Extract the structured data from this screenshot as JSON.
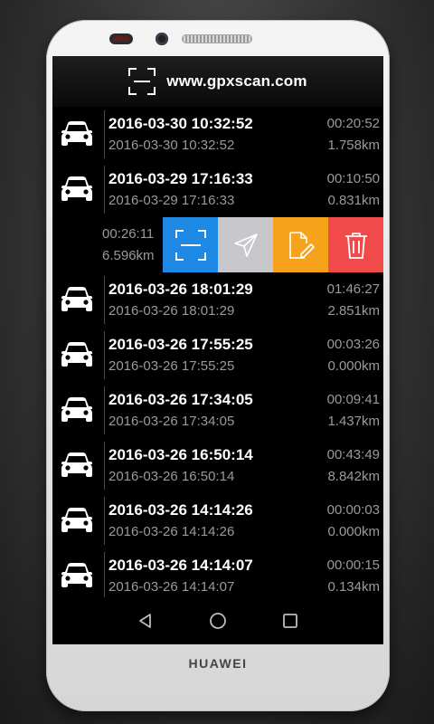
{
  "device": {
    "brand": "HUAWEI"
  },
  "header": {
    "title": "www.gpxscan.com",
    "logo_icon": "scan-frame-icon"
  },
  "tracks": [
    {
      "title": "2016-03-30 10:32:52",
      "subtitle": "2016-03-30 10:32:52",
      "duration": "00:20:52",
      "distance": "1.758km",
      "icon": "car-icon"
    },
    {
      "title": "2016-03-29 17:16:33",
      "subtitle": "2016-03-29 17:16:33",
      "duration": "00:10:50",
      "distance": "0.831km",
      "icon": "car-icon"
    }
  ],
  "swiped_track": {
    "duration": "00:26:11",
    "distance": "6.596km",
    "actions": [
      {
        "name": "scan",
        "icon": "scan-frame-icon",
        "color": "#1e88e5"
      },
      {
        "name": "share",
        "icon": "send-icon",
        "color": "#c8c8cc"
      },
      {
        "name": "edit",
        "icon": "edit-icon",
        "color": "#f7a21b"
      },
      {
        "name": "delete",
        "icon": "trash-icon",
        "color": "#f04a4a"
      }
    ]
  },
  "tracks_after": [
    {
      "title": "2016-03-26 18:01:29",
      "subtitle": "2016-03-26 18:01:29",
      "duration": "01:46:27",
      "distance": "2.851km",
      "icon": "car-icon"
    },
    {
      "title": "2016-03-26 17:55:25",
      "subtitle": "2016-03-26 17:55:25",
      "duration": "00:03:26",
      "distance": "0.000km",
      "icon": "car-icon"
    },
    {
      "title": "2016-03-26 17:34:05",
      "subtitle": "2016-03-26 17:34:05",
      "duration": "00:09:41",
      "distance": "1.437km",
      "icon": "car-icon"
    },
    {
      "title": "2016-03-26 16:50:14",
      "subtitle": "2016-03-26 16:50:14",
      "duration": "00:43:49",
      "distance": "8.842km",
      "icon": "car-icon"
    },
    {
      "title": "2016-03-26 14:14:26",
      "subtitle": "2016-03-26 14:14:26",
      "duration": "00:00:03",
      "distance": "0.000km",
      "icon": "car-icon"
    },
    {
      "title": "2016-03-26 14:14:07",
      "subtitle": "2016-03-26 14:14:07",
      "duration": "00:00:15",
      "distance": "0.134km",
      "icon": "car-icon"
    }
  ],
  "nav": [
    {
      "name": "back",
      "icon": "back-triangle-icon"
    },
    {
      "name": "home",
      "icon": "home-circle-icon"
    },
    {
      "name": "recents",
      "icon": "recents-square-icon"
    }
  ]
}
